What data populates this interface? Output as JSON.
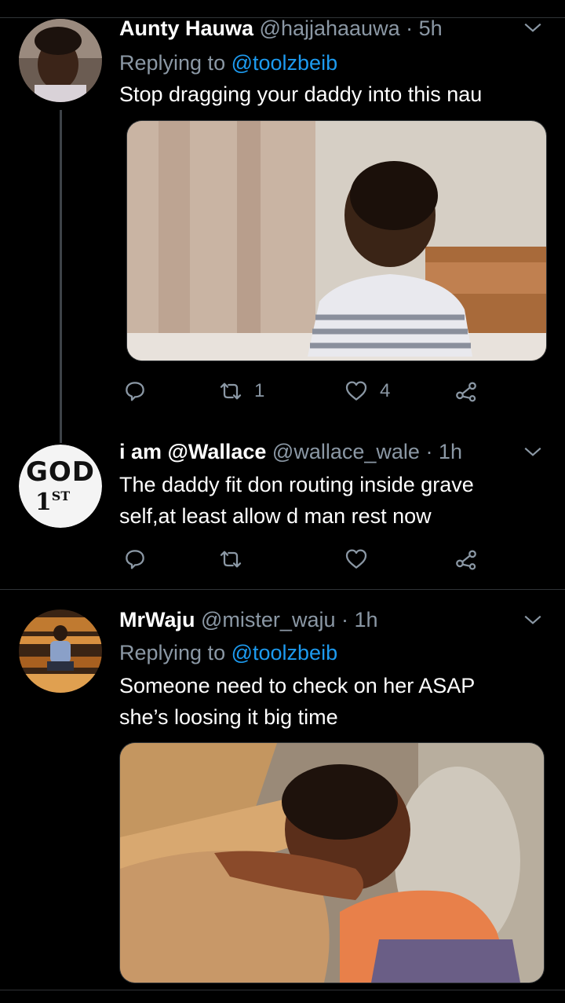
{
  "tweets": [
    {
      "name": "Aunty Hauwa",
      "handle": "@hajjahaauwa",
      "time": "· 5h",
      "replying_prefix": "Replying to ",
      "replying_to": "@toolzbeib",
      "text": "Stop dragging your daddy into this nau",
      "retweets": "1",
      "likes": "4"
    },
    {
      "name": "i am @Wallace",
      "handle": "@wallace_wale",
      "time": "· 1h",
      "text_line1": "The daddy fit don routing inside grave",
      "text_line2": "self,at least allow d man rest now",
      "avatar_text1": "GOD",
      "avatar_text2": "1",
      "avatar_sup": "ST"
    },
    {
      "name": "MrWaju",
      "handle": "@mister_waju",
      "time": "· 1h",
      "replying_prefix": "Replying to ",
      "replying_to": "@toolzbeib",
      "text_line1": "Someone need to check on her ASAP",
      "text_line2": "she’s loosing it big time"
    }
  ],
  "colors": {
    "background": "#000000",
    "secondary_text": "#8b98a5",
    "link": "#1d9bf0"
  }
}
